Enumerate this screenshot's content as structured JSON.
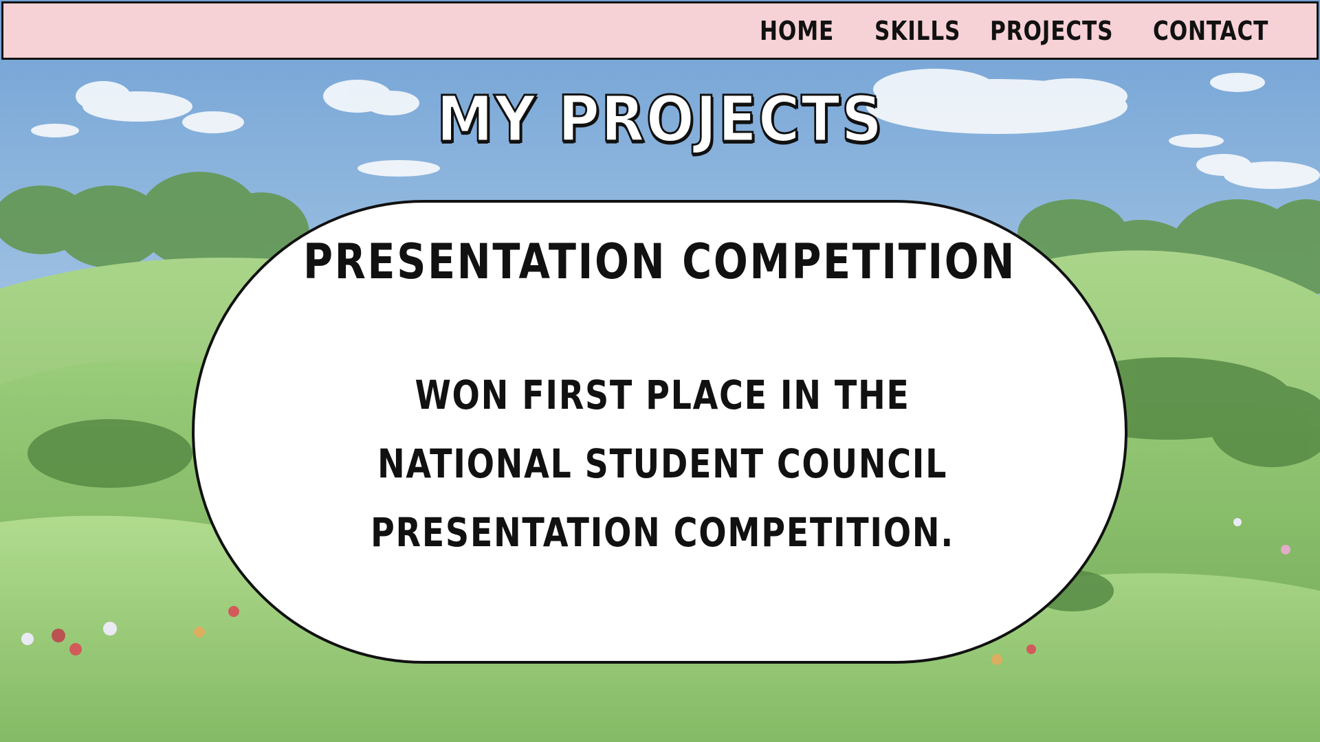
{
  "nav": {
    "items": [
      {
        "label": "HOME"
      },
      {
        "label": "SKILLS"
      },
      {
        "label": "PROJECTS"
      },
      {
        "label": "CONTACT"
      }
    ]
  },
  "page": {
    "title": "MY PROJECTS"
  },
  "project": {
    "title": "PRESENTATION COMPETITION",
    "description_lines": [
      "WON FIRST PLACE IN THE",
      "NATIONAL STUDENT COUNCIL",
      "PRESENTATION COMPETITION."
    ]
  },
  "colors": {
    "navbar_bg": "#f6d1d6",
    "card_bg": "#ffffff",
    "outline": "#111111",
    "sky": "#6fa3d6",
    "grass": "#8fc16a"
  }
}
